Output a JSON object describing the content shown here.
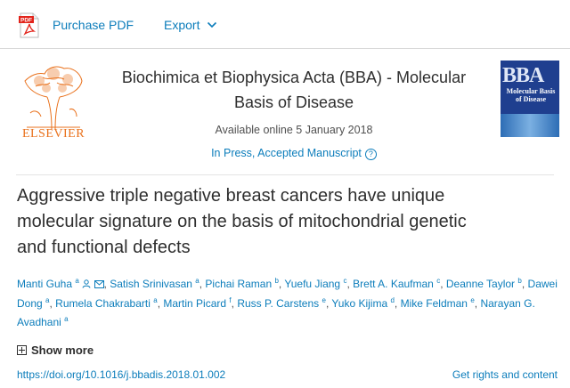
{
  "toolbar": {
    "pdf_badge": "PDF",
    "purchase_pdf": "Purchase PDF",
    "export": "Export"
  },
  "journal": {
    "publisher": "ELSEVIER",
    "title_line1": "Biochimica et Biophysica Acta (BBA) - Molecular",
    "title_line2": "Basis of Disease",
    "available": "Available online 5 January 2018",
    "status": "In Press, Accepted Manuscript",
    "cover": {
      "abbr": "BBA",
      "subtitle": "Molecular Basis of Disease",
      "color": "#1f3f8f"
    }
  },
  "article": {
    "title_line1": "Aggressive triple negative breast cancers have unique",
    "title_line2": "molecular signature on the basis of mitochondrial genetic",
    "title_line3": "and functional defects"
  },
  "authors": [
    {
      "name": "Manti Guha",
      "aff": "a"
    },
    {
      "name": "Satish Srinivasan",
      "aff": "a"
    },
    {
      "name": "Pichai Raman",
      "aff": "b"
    },
    {
      "name": "Yuefu Jiang",
      "aff": "c"
    },
    {
      "name": "Brett A. Kaufman",
      "aff": "c"
    },
    {
      "name": "Deanne Taylor",
      "aff": "b"
    },
    {
      "name": "Dawei Dong",
      "aff": "a"
    },
    {
      "name": "Rumela Chakrabarti",
      "aff": "a"
    },
    {
      "name": "Martin Picard",
      "aff": "f"
    },
    {
      "name": "Russ P. Carstens",
      "aff": "e"
    },
    {
      "name": "Yuko Kijima",
      "aff": "d"
    },
    {
      "name": "Mike Feldman",
      "aff": "e"
    },
    {
      "name": "Narayan G. Avadhani",
      "aff": "a"
    }
  ],
  "show_more": "Show more",
  "doi": "https://doi.org/10.1016/j.bbadis.2018.01.002",
  "rights": "Get rights and content",
  "colors": {
    "link": "#0c7dbb",
    "elsevier_orange": "#e9711c",
    "pdf_red": "#e2231a"
  }
}
